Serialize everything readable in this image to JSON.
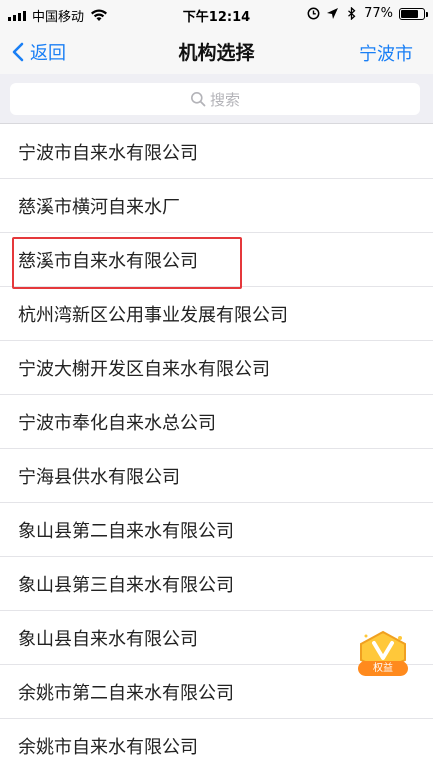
{
  "status_bar": {
    "carrier": "中国移动",
    "time": "下午12:14",
    "battery_percent": "77%",
    "battery_level": 0.77
  },
  "nav": {
    "back_label": "返回",
    "title": "机构选择",
    "right_label": "宁波市"
  },
  "search": {
    "placeholder": "搜索"
  },
  "list": {
    "items": [
      {
        "label": "宁波市自来水有限公司"
      },
      {
        "label": "慈溪市横河自来水厂"
      },
      {
        "label": "慈溪市自来水有限公司"
      },
      {
        "label": "杭州湾新区公用事业发展有限公司"
      },
      {
        "label": "宁波大榭开发区自来水有限公司"
      },
      {
        "label": "宁波市奉化自来水总公司"
      },
      {
        "label": "宁海县供水有限公司"
      },
      {
        "label": "象山县第二自来水有限公司"
      },
      {
        "label": "象山县第三自来水有限公司"
      },
      {
        "label": "象山县自来水有限公司"
      },
      {
        "label": "余姚市第二自来水有限公司"
      },
      {
        "label": "余姚市自来水有限公司"
      }
    ]
  },
  "badge": {
    "label": "权益"
  },
  "colors": {
    "accent": "#1a7ff5",
    "highlight_border": "#e5383b",
    "badge": "#ff8a1d"
  },
  "icons": [
    "signal-icon",
    "wifi-icon",
    "alarm-icon",
    "location-icon",
    "bluetooth-icon",
    "battery-icon",
    "chevron-left-icon",
    "search-icon",
    "badge-v-icon"
  ]
}
